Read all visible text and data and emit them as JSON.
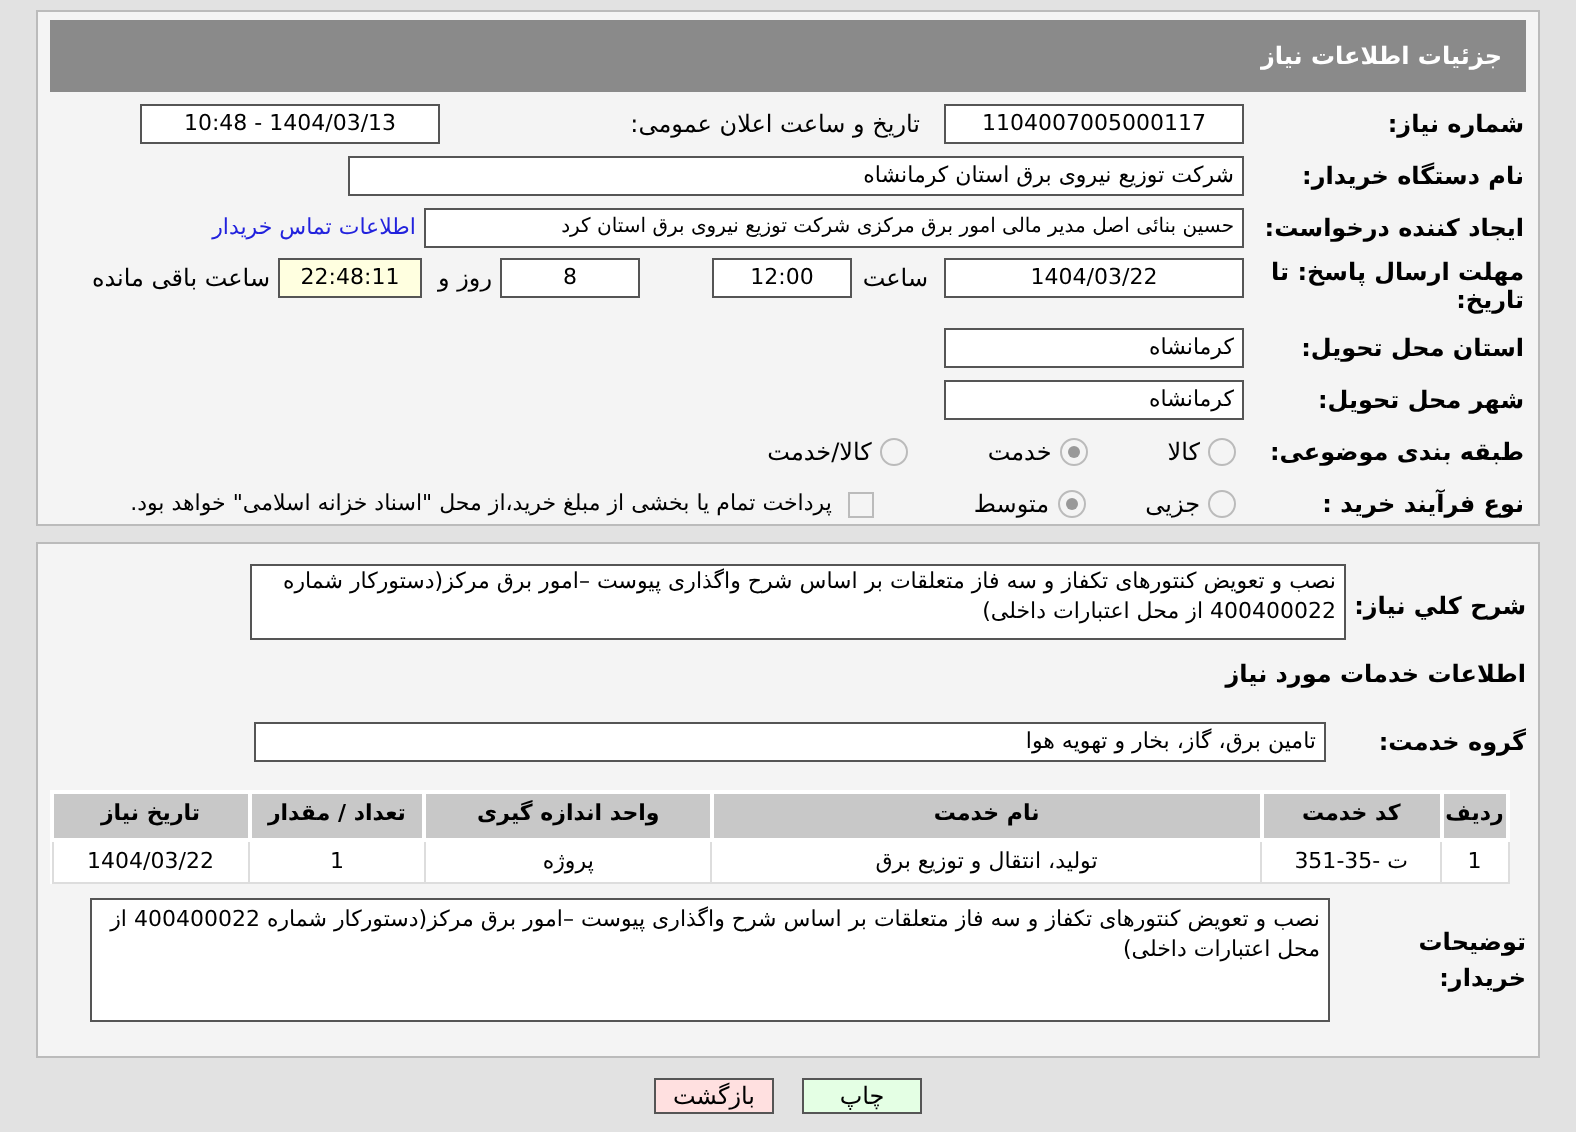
{
  "header": {
    "title": "جزئیات اطلاعات نیاز"
  },
  "need_number": {
    "label": "شماره نیاز:",
    "value": "1104007005000117"
  },
  "announce": {
    "label": "تاریخ و ساعت اعلان عمومی:",
    "value": "1404/03/13 - 10:48"
  },
  "buyer_org": {
    "label": "نام دستگاه خریدار:",
    "value": "شرکت توزیع نیروی برق استان کرمانشاه"
  },
  "creator": {
    "label": "ایجاد کننده درخواست:",
    "value": "حسین بنائی اصل مدیر مالی امور برق مرکزی شرکت توزیع نیروی برق استان کرد",
    "link": "اطلاعات تماس خریدار"
  },
  "deadline": {
    "label": "مهلت ارسال پاسخ: تا تاریخ:",
    "date": "1404/03/22",
    "time_label": "ساعت",
    "time": "12:00",
    "days": "8",
    "days_label": "روز و",
    "remaining": "22:48:11",
    "remaining_label": "ساعت باقی مانده"
  },
  "province": {
    "label": "استان محل تحویل:",
    "value": "کرمانشاه"
  },
  "city": {
    "label": "شهر محل تحویل:",
    "value": "کرمانشاه"
  },
  "category": {
    "label": "طبقه بندی موضوعی:",
    "options": [
      {
        "label": "کالا",
        "selected": false
      },
      {
        "label": "خدمت",
        "selected": true
      },
      {
        "label": "کالا/خدمت",
        "selected": false
      }
    ]
  },
  "process": {
    "label": "نوع فرآیند خرید :",
    "options": [
      {
        "label": "جزیی",
        "selected": false
      },
      {
        "label": "متوسط",
        "selected": true
      }
    ],
    "payment": {
      "label": "پرداخت تمام یا بخشی از مبلغ خرید،از محل \"اسناد خزانه اسلامی\" خواهد بود.",
      "checked": false
    }
  },
  "description": {
    "label": "شرح کلي نياز:",
    "value": "نصب و تعویض کنتورهای تکفاز و سه فاز  متعلقات بر اساس شرح واگذاری پیوست  –امور برق مرکز(دستورکار شماره 400400022 از محل اعتبارات داخلی)"
  },
  "services_title": "اطلاعات خدمات مورد نیاز",
  "service_group": {
    "label": "گروه خدمت:",
    "value": "تامین برق، گاز، بخار و تهویه هوا"
  },
  "table": {
    "columns": [
      "ردیف",
      "کد خدمت",
      "نام خدمت",
      "واحد اندازه گیری",
      "تعداد / مقدار",
      "تاریخ نیاز"
    ],
    "rows": [
      [
        "1",
        "ت -35-351",
        "تولید، انتقال و توزیع برق",
        "پروژه",
        "1",
        "1404/03/22"
      ]
    ]
  },
  "buyer_notes": {
    "label": "توضیحات خریدار:",
    "value": "نصب و تعویض کنتورهای تکفاز و سه فاز  متعلقات بر اساس شرح واگذاری پیوست  –امور برق مرکز(دستورکار شماره 400400022 از محل اعتبارات داخلی)"
  },
  "buttons": [
    {
      "kind": "print",
      "label": "چاپ"
    },
    {
      "kind": "back",
      "label": "بازگشت"
    }
  ]
}
